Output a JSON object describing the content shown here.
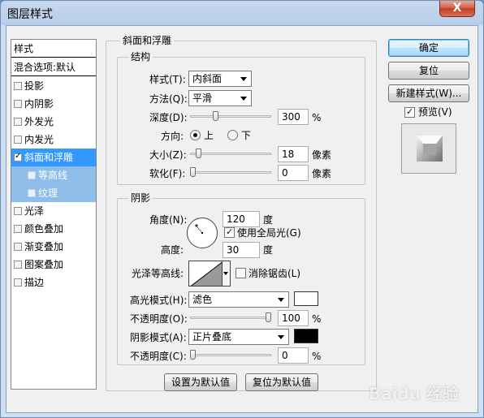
{
  "window": {
    "title": "图层样式",
    "close_label": "X"
  },
  "left_list": {
    "header": "样式",
    "blend_options": "混合选项:默认",
    "items": [
      {
        "label": "投影",
        "checked": false
      },
      {
        "label": "内阴影",
        "checked": false
      },
      {
        "label": "外发光",
        "checked": false
      },
      {
        "label": "内发光",
        "checked": false
      },
      {
        "label": "斜面和浮雕",
        "checked": true,
        "selected": true
      },
      {
        "label": "等高线",
        "checked": false,
        "sub": true
      },
      {
        "label": "纹理",
        "checked": false,
        "sub": true
      },
      {
        "label": "光泽",
        "checked": false
      },
      {
        "label": "颜色叠加",
        "checked": false
      },
      {
        "label": "渐变叠加",
        "checked": false
      },
      {
        "label": "图案叠加",
        "checked": false
      },
      {
        "label": "描边",
        "checked": false
      }
    ]
  },
  "bevel": {
    "section_title": "斜面和浮雕",
    "structure": {
      "title": "结构",
      "style_label": "样式(T):",
      "style_value": "内斜面",
      "technique_label": "方法(Q):",
      "technique_value": "平滑",
      "depth_label": "深度(D):",
      "depth_value": "300",
      "depth_unit": "%",
      "depth_fraction": 0.3,
      "direction_label": "方向:",
      "direction_up": "上",
      "direction_down": "下",
      "size_label": "大小(Z):",
      "size_value": "18",
      "size_unit": "像素",
      "size_fraction": 0.07,
      "soften_label": "软化(F):",
      "soften_value": "0",
      "soften_unit": "像素",
      "soften_fraction": 0.0
    },
    "shading": {
      "title": "阴影",
      "angle_label": "角度(N):",
      "angle_value": "120",
      "angle_unit": "度",
      "global_light_label": "使用全局光(G)",
      "altitude_label": "高度:",
      "altitude_value": "30",
      "altitude_unit": "度",
      "gloss_contour_label": "光泽等高线:",
      "anti_alias_label": "消除锯齿(L)",
      "highlight_mode_label": "高光模式(H):",
      "highlight_mode_value": "滤色",
      "highlight_color": "#ffffff",
      "highlight_opacity_label": "不透明度(O):",
      "highlight_opacity_value": "100",
      "highlight_opacity_unit": "%",
      "highlight_opacity_fraction": 1.0,
      "shadow_mode_label": "阴影模式(A):",
      "shadow_mode_value": "正片叠底",
      "shadow_color": "#000000",
      "shadow_opacity_label": "不透明度(C):",
      "shadow_opacity_value": "0",
      "shadow_opacity_unit": "%",
      "shadow_opacity_fraction": 0.0
    },
    "make_default": "设置为默认值",
    "reset_default": "复位为默认值"
  },
  "right": {
    "ok": "确定",
    "reset": "复位",
    "new_style": "新建样式(W)...",
    "preview_label": "预览(V)"
  },
  "watermark": "Baidu 经验"
}
